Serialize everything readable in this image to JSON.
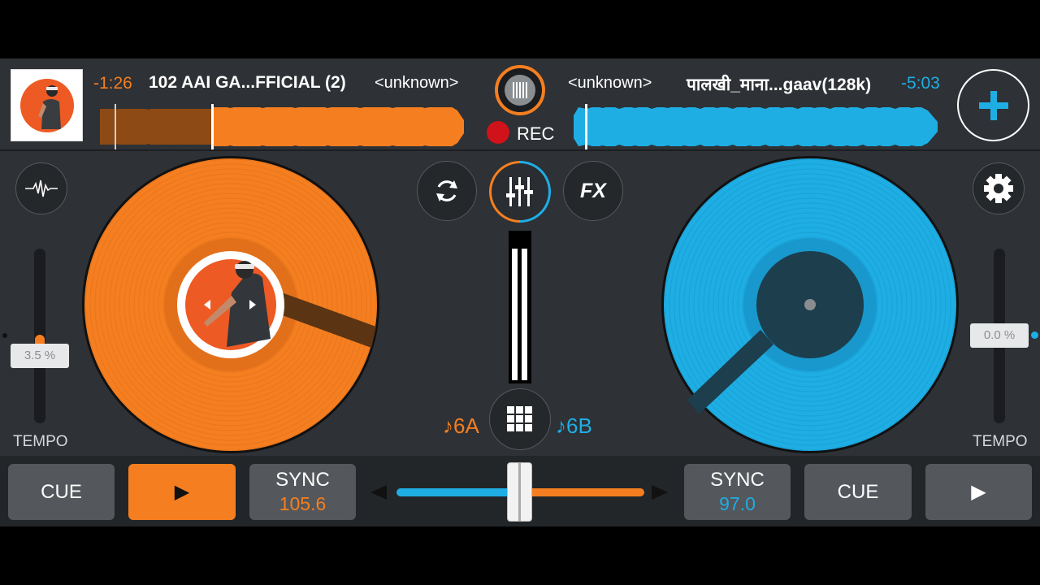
{
  "deck_a": {
    "time_remaining": "-1:26",
    "title": "102 AAI GA...FFICIAL (2)",
    "artist": "<unknown>",
    "tempo": "3.5 %",
    "tempo_label": "TEMPO",
    "bpm": "105.6",
    "key": "♪6A",
    "cue_label": "CUE",
    "sync_label": "SYNC",
    "play_icon": "▶"
  },
  "deck_b": {
    "time_remaining": "-5:03",
    "title": "पालखी_माना...gaav(128k)",
    "artist": "<unknown>",
    "tempo": "0.0 %",
    "tempo_label": "TEMPO",
    "bpm": "97.0",
    "key": "♪6B",
    "cue_label": "CUE",
    "sync_label": "SYNC",
    "play_icon": "▶"
  },
  "recorder": {
    "label": "REC"
  },
  "center_buttons": {
    "fx_label": "FX"
  },
  "crossfader": {
    "position": 0.5
  },
  "colors": {
    "deck_a": "#f57f20",
    "deck_b": "#1eaee4",
    "background": "#2e3135",
    "rec": "#d0121b"
  },
  "icons": [
    "add-icon",
    "waveform-icon",
    "gear-icon",
    "loop-icon",
    "mixer-icon",
    "fx-icon",
    "grid-icon",
    "play-icon",
    "record-icon"
  ]
}
